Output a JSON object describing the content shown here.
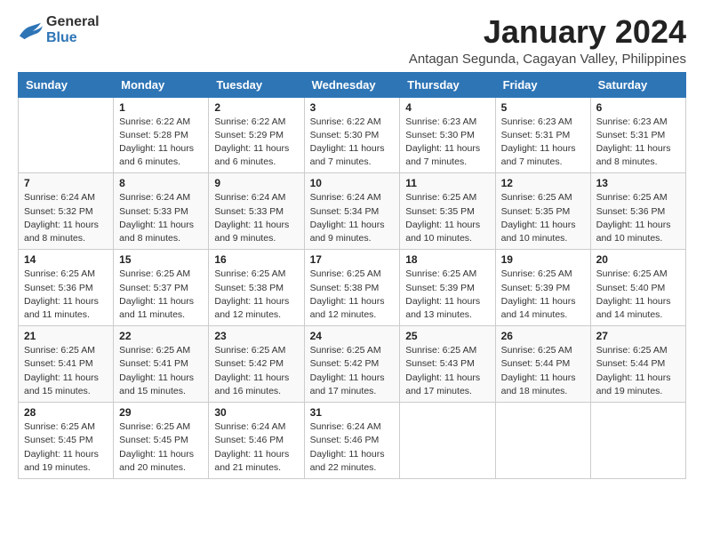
{
  "logo": {
    "line1": "General",
    "line2": "Blue"
  },
  "calendar": {
    "title": "January 2024",
    "subtitle": "Antagan Segunda, Cagayan Valley, Philippines",
    "headers": [
      "Sunday",
      "Monday",
      "Tuesday",
      "Wednesday",
      "Thursday",
      "Friday",
      "Saturday"
    ],
    "weeks": [
      [
        {
          "day": "",
          "info": ""
        },
        {
          "day": "1",
          "info": "Sunrise: 6:22 AM\nSunset: 5:28 PM\nDaylight: 11 hours\nand 6 minutes."
        },
        {
          "day": "2",
          "info": "Sunrise: 6:22 AM\nSunset: 5:29 PM\nDaylight: 11 hours\nand 6 minutes."
        },
        {
          "day": "3",
          "info": "Sunrise: 6:22 AM\nSunset: 5:30 PM\nDaylight: 11 hours\nand 7 minutes."
        },
        {
          "day": "4",
          "info": "Sunrise: 6:23 AM\nSunset: 5:30 PM\nDaylight: 11 hours\nand 7 minutes."
        },
        {
          "day": "5",
          "info": "Sunrise: 6:23 AM\nSunset: 5:31 PM\nDaylight: 11 hours\nand 7 minutes."
        },
        {
          "day": "6",
          "info": "Sunrise: 6:23 AM\nSunset: 5:31 PM\nDaylight: 11 hours\nand 8 minutes."
        }
      ],
      [
        {
          "day": "7",
          "info": "Sunrise: 6:24 AM\nSunset: 5:32 PM\nDaylight: 11 hours\nand 8 minutes."
        },
        {
          "day": "8",
          "info": "Sunrise: 6:24 AM\nSunset: 5:33 PM\nDaylight: 11 hours\nand 8 minutes."
        },
        {
          "day": "9",
          "info": "Sunrise: 6:24 AM\nSunset: 5:33 PM\nDaylight: 11 hours\nand 9 minutes."
        },
        {
          "day": "10",
          "info": "Sunrise: 6:24 AM\nSunset: 5:34 PM\nDaylight: 11 hours\nand 9 minutes."
        },
        {
          "day": "11",
          "info": "Sunrise: 6:25 AM\nSunset: 5:35 PM\nDaylight: 11 hours\nand 10 minutes."
        },
        {
          "day": "12",
          "info": "Sunrise: 6:25 AM\nSunset: 5:35 PM\nDaylight: 11 hours\nand 10 minutes."
        },
        {
          "day": "13",
          "info": "Sunrise: 6:25 AM\nSunset: 5:36 PM\nDaylight: 11 hours\nand 10 minutes."
        }
      ],
      [
        {
          "day": "14",
          "info": "Sunrise: 6:25 AM\nSunset: 5:36 PM\nDaylight: 11 hours\nand 11 minutes."
        },
        {
          "day": "15",
          "info": "Sunrise: 6:25 AM\nSunset: 5:37 PM\nDaylight: 11 hours\nand 11 minutes."
        },
        {
          "day": "16",
          "info": "Sunrise: 6:25 AM\nSunset: 5:38 PM\nDaylight: 11 hours\nand 12 minutes."
        },
        {
          "day": "17",
          "info": "Sunrise: 6:25 AM\nSunset: 5:38 PM\nDaylight: 11 hours\nand 12 minutes."
        },
        {
          "day": "18",
          "info": "Sunrise: 6:25 AM\nSunset: 5:39 PM\nDaylight: 11 hours\nand 13 minutes."
        },
        {
          "day": "19",
          "info": "Sunrise: 6:25 AM\nSunset: 5:39 PM\nDaylight: 11 hours\nand 14 minutes."
        },
        {
          "day": "20",
          "info": "Sunrise: 6:25 AM\nSunset: 5:40 PM\nDaylight: 11 hours\nand 14 minutes."
        }
      ],
      [
        {
          "day": "21",
          "info": "Sunrise: 6:25 AM\nSunset: 5:41 PM\nDaylight: 11 hours\nand 15 minutes."
        },
        {
          "day": "22",
          "info": "Sunrise: 6:25 AM\nSunset: 5:41 PM\nDaylight: 11 hours\nand 15 minutes."
        },
        {
          "day": "23",
          "info": "Sunrise: 6:25 AM\nSunset: 5:42 PM\nDaylight: 11 hours\nand 16 minutes."
        },
        {
          "day": "24",
          "info": "Sunrise: 6:25 AM\nSunset: 5:42 PM\nDaylight: 11 hours\nand 17 minutes."
        },
        {
          "day": "25",
          "info": "Sunrise: 6:25 AM\nSunset: 5:43 PM\nDaylight: 11 hours\nand 17 minutes."
        },
        {
          "day": "26",
          "info": "Sunrise: 6:25 AM\nSunset: 5:44 PM\nDaylight: 11 hours\nand 18 minutes."
        },
        {
          "day": "27",
          "info": "Sunrise: 6:25 AM\nSunset: 5:44 PM\nDaylight: 11 hours\nand 19 minutes."
        }
      ],
      [
        {
          "day": "28",
          "info": "Sunrise: 6:25 AM\nSunset: 5:45 PM\nDaylight: 11 hours\nand 19 minutes."
        },
        {
          "day": "29",
          "info": "Sunrise: 6:25 AM\nSunset: 5:45 PM\nDaylight: 11 hours\nand 20 minutes."
        },
        {
          "day": "30",
          "info": "Sunrise: 6:24 AM\nSunset: 5:46 PM\nDaylight: 11 hours\nand 21 minutes."
        },
        {
          "day": "31",
          "info": "Sunrise: 6:24 AM\nSunset: 5:46 PM\nDaylight: 11 hours\nand 22 minutes."
        },
        {
          "day": "",
          "info": ""
        },
        {
          "day": "",
          "info": ""
        },
        {
          "day": "",
          "info": ""
        }
      ]
    ]
  }
}
